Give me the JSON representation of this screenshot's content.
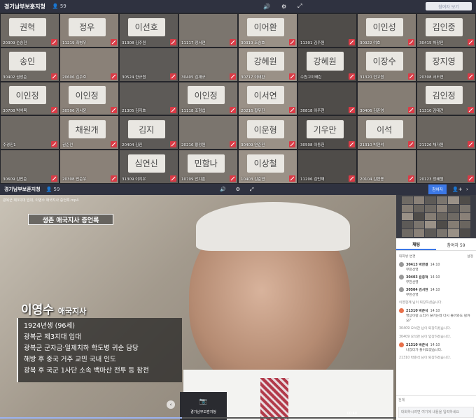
{
  "top": {
    "title": "경기남부보훈지청",
    "count": "59",
    "right_button": "참여자 보기"
  },
  "tiles": [
    {
      "label": "20309 손승현",
      "paper": "권혁"
    },
    {
      "label": "11219 최병우",
      "paper": "정우"
    },
    {
      "label": "31308 김주원",
      "paper": "이선호"
    },
    {
      "label": "11117 정서연",
      "paper": ""
    },
    {
      "label": "30319 조승호",
      "paper": "이어환"
    },
    {
      "label": "11301 김주원",
      "paper": ""
    },
    {
      "label": "30922 여호",
      "paper": "이인성"
    },
    {
      "label": "30415 허창민",
      "paper": "김인중"
    },
    {
      "label": "30402 권성준",
      "paper": "송인"
    },
    {
      "label": "20606 김주호",
      "paper": ""
    },
    {
      "label": "30524 한규원",
      "paper": ""
    },
    {
      "label": "30405 김재규",
      "paper": ""
    },
    {
      "label": "30717 이태환",
      "paper": "강혜원"
    },
    {
      "label": "수원고이태린",
      "paper": "강혜원"
    },
    {
      "label": "31320 현고원",
      "paper": "이장수"
    },
    {
      "label": "20308 서도연",
      "paper": "장지영"
    },
    {
      "label": "30708 박석목",
      "paper": "이인정"
    },
    {
      "label": "30506 김서윤",
      "paper": "이인정"
    },
    {
      "label": "21305 김지호",
      "paper": ""
    },
    {
      "label": "11118 조형섭",
      "paper": "이인정"
    },
    {
      "label": "20216 황우진",
      "paper": "이서연"
    },
    {
      "label": "30818 이주현",
      "paper": ""
    },
    {
      "label": "30406 김준영",
      "paper": ""
    },
    {
      "label": "11310 김태건",
      "paper": "김인정"
    },
    {
      "label": "주경진1",
      "paper": ""
    },
    {
      "label": "권준전",
      "paper": "채원개"
    },
    {
      "label": "20404 김진",
      "paper": "김지"
    },
    {
      "label": "20216 황정원",
      "paper": ""
    },
    {
      "label": "30409 연준민",
      "paper": "이운형"
    },
    {
      "label": "30508 이동헌",
      "paper": "기우만"
    },
    {
      "label": "21310 박현석",
      "paper": "이석"
    },
    {
      "label": "21126 채가원",
      "paper": ""
    },
    {
      "label": "30609 김민준",
      "paper": ""
    },
    {
      "label": "20308 민준우",
      "paper": ""
    },
    {
      "label": "31309 이지우",
      "paper": "심연신"
    },
    {
      "label": "10709 안지훈",
      "paper": "민함나"
    },
    {
      "label": "10403 김준엽",
      "paper": "이상철"
    },
    {
      "label": "11206 김민재",
      "paper": ""
    },
    {
      "label": "20104 김현용",
      "paper": ""
    },
    {
      "label": "20123 정혜원",
      "paper": ""
    }
  ],
  "sub": {
    "title": "경기남부보훈지청",
    "count": "59",
    "blue_button": "참여자"
  },
  "video": {
    "file": "광복군 제3지대 입대, 이영수 애국지사 증언록.mp4",
    "banner": "생존 애국지사 증언록",
    "name": "이영수",
    "name_suffix": "애국지사",
    "info": [
      "1924년생 (96세)",
      "광복군 제3지대 입대",
      "광복군 군자금·일제치하 학도병 귀순 담당",
      "해방 후 중국 거주 교민 국내 인도",
      "광복 후 국군 1사단 소속 백마산 전투 등 참전"
    ],
    "time": "00:40",
    "camtile_label": "경기남부보훈지청"
  },
  "side": {
    "tab_chat": "채팅",
    "tab_people": "참여자 59",
    "chat_header": "대화방 변경",
    "chat_header_right": "설정",
    "messages": [
      {
        "type": "msg",
        "name": "30413 박한결",
        "time": "14:10",
        "text": "무한선영",
        "orange": false
      },
      {
        "type": "msg",
        "name": "30403 윤종혁",
        "time": "14:10",
        "text": "무한선영",
        "orange": false
      },
      {
        "type": "msg",
        "name": "30504 김서현",
        "time": "14:10",
        "text": "무한선영",
        "orange": false
      },
      {
        "type": "sys",
        "text": "이영현께 님이 퇴장하셨습니다."
      },
      {
        "type": "msg",
        "name": "21310 박준석",
        "time": "14:10",
        "text": "영상이랑 소리가 끊기는데 다시 들어와도 될까요?",
        "orange": true
      },
      {
        "type": "sys",
        "text": "30409 오석찬 님이 퇴장하셨습니다."
      },
      {
        "type": "sys",
        "text": "30409 오석찬 님이 입장하셨습니다."
      },
      {
        "type": "msg",
        "name": "21310 박준석",
        "time": "14:10",
        "text": "나갔다가 들어오겠습니다.",
        "orange": true
      },
      {
        "type": "sys",
        "text": "21310 박준석 님이 퇴장하셨습니다."
      }
    ],
    "input_target": "전체",
    "input_placeholder": "대화하시려면 여기에 내용을 입력하세요"
  }
}
